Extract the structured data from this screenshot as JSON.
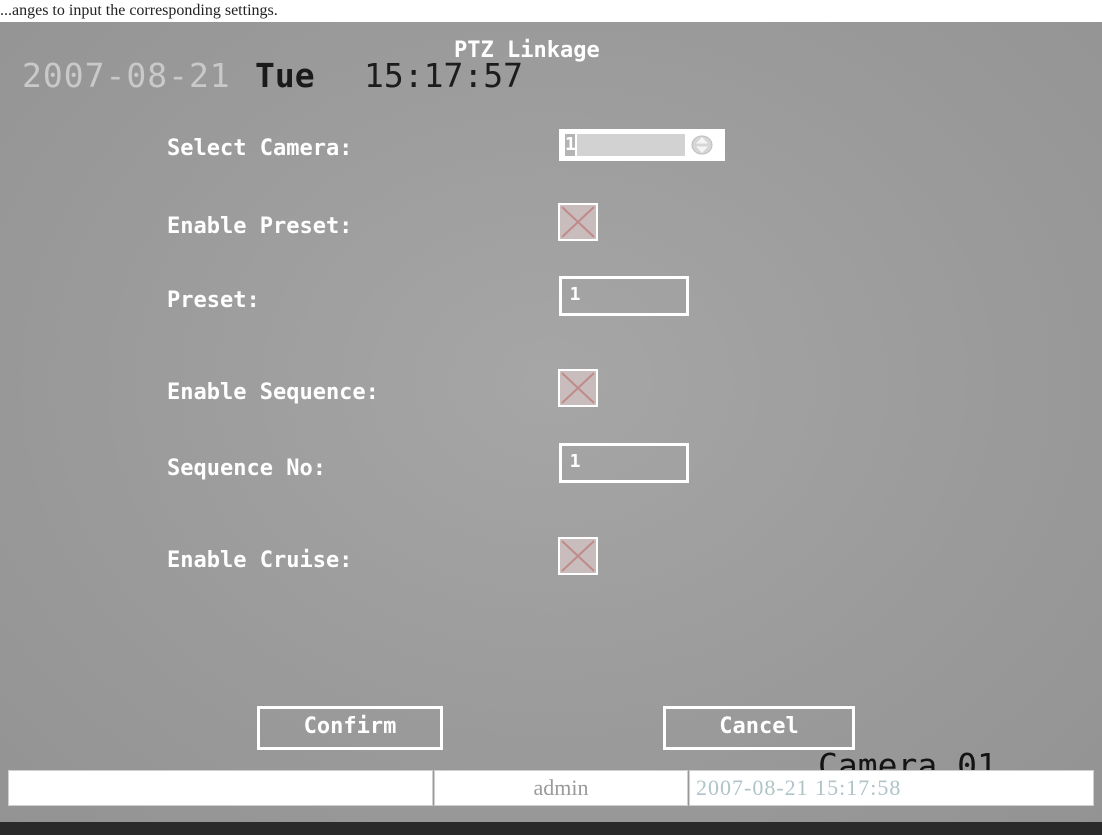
{
  "caption": "...anges to input the corresponding settings.",
  "osd": {
    "date": "2007-08-21",
    "day": "Tue",
    "time": "15:17:57",
    "camera_label": "Camera 01"
  },
  "menu": {
    "title": "PTZ Linkage",
    "fields": {
      "select_camera": {
        "label": "Select Camera:",
        "value": "1"
      },
      "enable_preset": {
        "label": "Enable Preset:",
        "checked": true
      },
      "preset": {
        "label": "Preset:",
        "value": "1"
      },
      "enable_sequence": {
        "label": "Enable Sequence:",
        "checked": true
      },
      "sequence_no": {
        "label": "Sequence No:",
        "value": "1"
      },
      "enable_cruise": {
        "label": "Enable Cruise:",
        "checked": true
      }
    },
    "buttons": {
      "confirm": "Confirm",
      "cancel": "Cancel"
    }
  },
  "statusbar": {
    "user": "admin",
    "datetime": "2007-08-21 15:17:58"
  },
  "colors": {
    "screen_bg": "#9d9d9d",
    "checkbox_fill": "#c9bcbc",
    "checkbox_x": "#c18a8a",
    "osd_date": "#c9c9c9",
    "status_user_text": "#9a9a9a",
    "status_date_text": "#b0c4c8"
  },
  "icons": {
    "spinner": "up-down-spinner-icon",
    "check": "x-checkmark-icon"
  }
}
